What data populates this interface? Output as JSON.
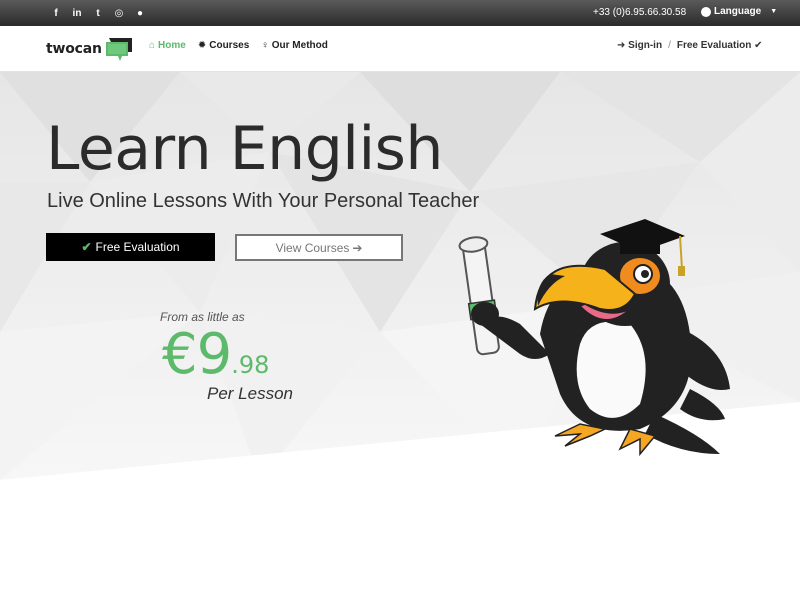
{
  "topbar": {
    "social_icons": [
      "facebook-icon",
      "linkedin-icon",
      "twitter-icon",
      "instagram-icon",
      "wechat-icon"
    ],
    "social_glyphs": [
      "f",
      "in",
      "t",
      "◎",
      "●"
    ],
    "phone": "+33 (0)6.95.66.30.58",
    "language_label": "Language",
    "caret": "▼"
  },
  "navbar": {
    "logo_text": "twocan",
    "items": [
      {
        "label": "Home",
        "icon": "home-icon",
        "glyph": "⌂",
        "active": true
      },
      {
        "label": "Courses",
        "icon": "gear-icon",
        "glyph": "✹",
        "active": false
      },
      {
        "label": "Our Method",
        "icon": "lightbulb-icon",
        "glyph": "♀",
        "active": false
      }
    ],
    "signin_label": "Sign-in",
    "signin_glyph": "➜",
    "separator": "/",
    "eval_label": "Free Evaluation",
    "eval_glyph": "✔"
  },
  "hero": {
    "title": "Learn English",
    "subtitle": "Live Online Lessons With Your Personal Teacher",
    "primary_button": "Free Evaluation",
    "primary_glyph": "✔",
    "secondary_button": "View Courses",
    "secondary_glyph": "➔",
    "price_prefix": "From as little as",
    "price_main": "€9",
    "price_cents": ".98",
    "price_suffix": "Per Lesson"
  },
  "colors": {
    "accent": "#5dba6b",
    "topbar": "#3a3a3a",
    "text": "#2b2b2b"
  }
}
